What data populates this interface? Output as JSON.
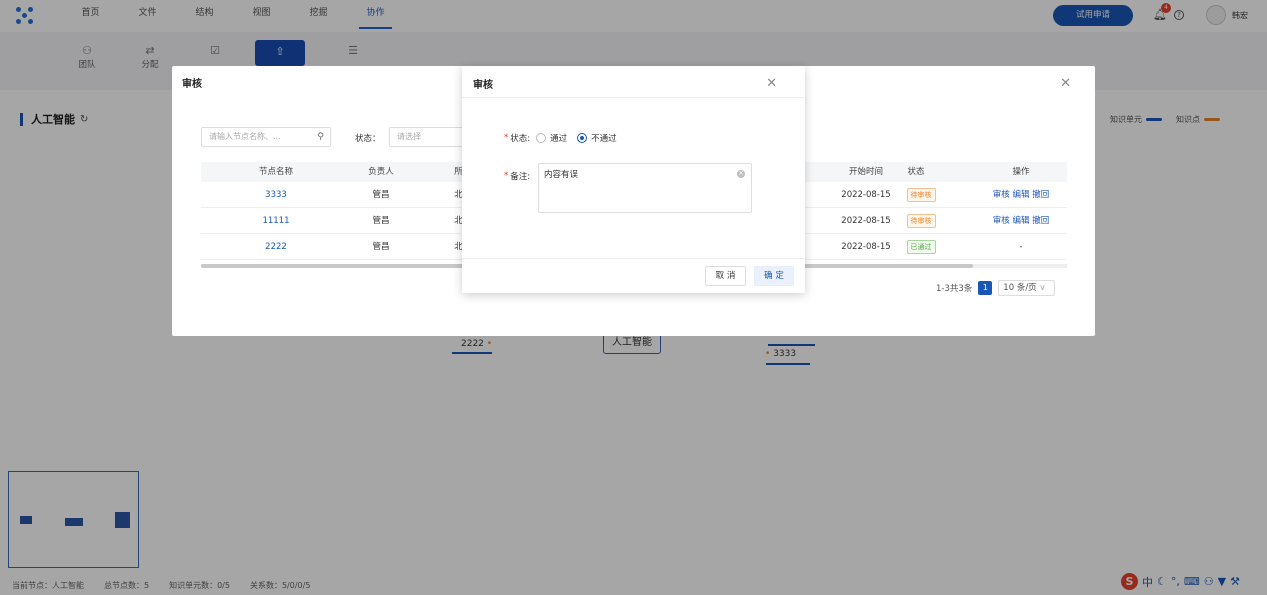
{
  "nav": {
    "items": [
      "首页",
      "文件",
      "结构",
      "视图",
      "挖掘",
      "协作"
    ],
    "active_index": 5,
    "trial_button": "试用申请",
    "notification_count": "4",
    "username": "韩宏"
  },
  "toolbar": {
    "items": [
      {
        "label": "团队",
        "icon": "team-icon"
      },
      {
        "label": "分配",
        "icon": "assign-icon"
      }
    ]
  },
  "page": {
    "title": "人工智能",
    "legend": [
      {
        "label": "知识单元",
        "color": "#1a56b5"
      },
      {
        "label": "知识点",
        "color": "#e8862c"
      }
    ]
  },
  "mindmap": {
    "center": "人工智能",
    "left_node": "2222",
    "right_node": "3333"
  },
  "status_bar": {
    "current": "当前节点：人工智能",
    "total": "总节点数：5",
    "units": "知识单元数：0/5",
    "relations": "关系数：5/0/0/5"
  },
  "review_dialog": {
    "title": "审核",
    "search_placeholder": "请输入节点名称、...",
    "status_label": "状态：",
    "status_placeholder": "请选择",
    "columns": [
      "节点名称",
      "负责人",
      "所",
      "开始时间",
      "状态",
      "操作"
    ],
    "rows": [
      {
        "name": "3333",
        "owner": "管昌",
        "org": "北",
        "start": "2022-08-15",
        "status": "待审核",
        "status_type": "pending",
        "actions": [
          "审核",
          "编辑",
          "撤回"
        ]
      },
      {
        "name": "11111",
        "owner": "管昌",
        "org": "北",
        "start": "2022-08-15",
        "status": "待审核",
        "status_type": "pending",
        "actions": [
          "审核",
          "编辑",
          "撤回"
        ]
      },
      {
        "name": "2222",
        "owner": "管昌",
        "org": "北",
        "start": "2022-08-15",
        "status": "已通过",
        "status_type": "pass",
        "actions": [
          "-"
        ]
      }
    ],
    "pagination": {
      "summary": "1-3共3条",
      "page": "1",
      "page_size": "10 条/页"
    }
  },
  "approve_dialog": {
    "title": "审核",
    "status_label": "状态:",
    "option_pass": "通过",
    "option_reject": "不通过",
    "selected": "不通过",
    "remark_label": "备注:",
    "remark_value": "内容有误",
    "cancel": "取 消",
    "confirm": "确 定"
  },
  "ime": {
    "label": "中"
  }
}
